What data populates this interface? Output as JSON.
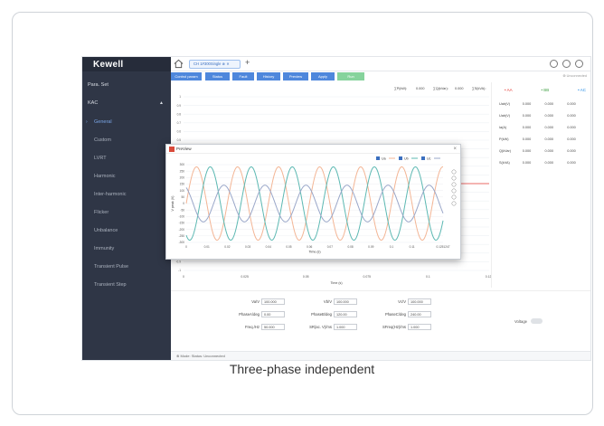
{
  "app": {
    "logo": "Kewell"
  },
  "sidebar": {
    "items": [
      {
        "label": "Para. Set",
        "type": "section"
      },
      {
        "label": "KAC",
        "type": "group"
      },
      {
        "label": "General",
        "type": "active"
      },
      {
        "label": "Custom",
        "type": "sub"
      },
      {
        "label": "LVRT",
        "type": "sub"
      },
      {
        "label": "Harmonic",
        "type": "sub"
      },
      {
        "label": "Inter-harmonic",
        "type": "sub"
      },
      {
        "label": "Flicker",
        "type": "sub"
      },
      {
        "label": "Unbalance",
        "type": "sub"
      },
      {
        "label": "Immunity",
        "type": "sub"
      },
      {
        "label": "Transient Pulse",
        "type": "sub"
      },
      {
        "label": "Transient Step",
        "type": "sub"
      }
    ]
  },
  "tab": {
    "label": "CH 1#300Single ⊗ ✕"
  },
  "toolbar": {
    "buttons": [
      "Control param",
      "Status",
      "Fault",
      "History",
      "Preview",
      "Apply",
      "Run"
    ],
    "connection": "⊗ Unconnected"
  },
  "readouts": {
    "items": [
      {
        "label": "∑P(kW):",
        "value": "0.000"
      },
      {
        "label": "∑Q(kVar):",
        "value": "0.000"
      },
      {
        "label": "∑S(kVA):",
        "value": "0.000"
      },
      {
        "label": "f(Hz):",
        "value": "0.000"
      }
    ]
  },
  "phases": {
    "a": "• AA",
    "b": "• BB",
    "c": "• AC"
  },
  "right_panel": {
    "rows": [
      {
        "label": "Uab(V)",
        "values": [
          "0.000",
          "0.000",
          "0.000"
        ]
      },
      {
        "label": "Uab(V)",
        "values": [
          "0.000",
          "0.000",
          "0.000"
        ]
      },
      {
        "label": "Ia(A)",
        "values": [
          "0.000",
          "0.000",
          "0.000"
        ]
      },
      {
        "label": "P(kW)",
        "values": [
          "0.000",
          "0.000",
          "0.000"
        ]
      },
      {
        "label": "Q(kVar)",
        "values": [
          "0.000",
          "0.000",
          "0.000"
        ]
      },
      {
        "label": "S(kVA)",
        "values": [
          "0.000",
          "0.000",
          "0.000"
        ]
      }
    ]
  },
  "form": {
    "fields": [
      {
        "label": "Va/V",
        "value": "100.000"
      },
      {
        "label": "Vb/V",
        "value": "100.000"
      },
      {
        "label": "Vc/V",
        "value": "100.000"
      },
      {
        "label": "PhaseA/deg",
        "value": "0.00"
      },
      {
        "label": "PhaseB/deg",
        "value": "120.00"
      },
      {
        "label": "PhaseC/deg",
        "value": "240.00"
      },
      {
        "label": "Freq./Hz",
        "value": "50.000"
      },
      {
        "label": "SR(ac. V)/ms",
        "value": "1.000"
      },
      {
        "label": "SFreq(Hz)/ms",
        "value": "1.000"
      }
    ],
    "voltage_label": "Voltage"
  },
  "status_bar": "⊗  Mode:    Status:  Unconnected",
  "preview": {
    "title": "PreView",
    "legend": [
      "Ua",
      "Ub",
      "Uc"
    ]
  },
  "caption": "Three-phase independent",
  "chart_data": [
    {
      "type": "line",
      "xlabel": "Time (s)",
      "ylabel": "V peak (V)",
      "x_ticks": [
        "0",
        "0.025",
        "0.05",
        "0.075",
        "0.1",
        "0.125"
      ],
      "y_ticks": [
        "1",
        "0.9",
        "0.8",
        "0.7",
        "0.6",
        "0.5",
        "0.4",
        "0.3",
        "0.2",
        "0.1",
        "0",
        "-0.1",
        "-0.2",
        "-0.3",
        "-0.4",
        "-0.5",
        "-0.6",
        "-0.7",
        "-0.8",
        "-0.9",
        "-1"
      ],
      "xlim": [
        0,
        0.125
      ],
      "ylim": [
        -1,
        1
      ],
      "series": [
        {
          "values": [
            0,
            0
          ],
          "x": [
            0,
            0.125
          ]
        }
      ],
      "colors": {
        "line": "#e53935"
      }
    },
    {
      "type": "line",
      "xlabel": "Time (s)",
      "ylabel": "V peak (V)",
      "x_ticks": [
        "0",
        "0.01",
        "0.02",
        "0.03",
        "0.04",
        "0.05",
        "0.06",
        "0.07",
        "0.08",
        "0.09",
        "0.1",
        "0.11",
        "0.1251247"
      ],
      "y_ticks": [
        "300",
        "250",
        "200",
        "150",
        "100",
        "50",
        "0",
        "-50",
        "-100",
        "-150",
        "-200",
        "-250",
        "-300"
      ],
      "xlim": [
        0,
        0.1251247
      ],
      "ylim": [
        -300,
        300
      ],
      "series": [
        {
          "name": "Ua",
          "amplitude": 282.8,
          "frequency_hz": 50,
          "phase_deg": 0,
          "color": "#f3b595"
        },
        {
          "name": "Ub",
          "amplitude": 282.8,
          "frequency_hz": 50,
          "phase_deg": 120,
          "color": "#5cb8b2"
        },
        {
          "name": "Uc",
          "amplitude": 141.4,
          "frequency_hz": 50,
          "phase_deg": 240,
          "color": "#9aa7c9"
        }
      ]
    }
  ]
}
